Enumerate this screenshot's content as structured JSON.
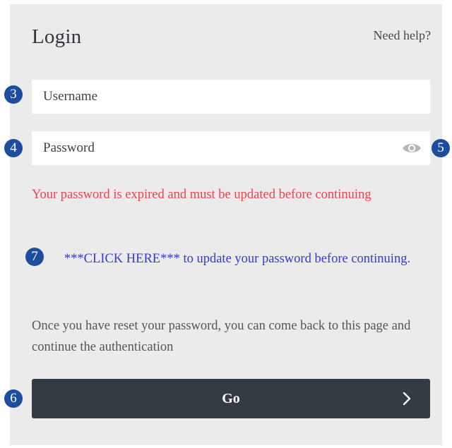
{
  "header": {
    "title": "Login",
    "help_link": "Need help?"
  },
  "form": {
    "username": {
      "placeholder": "Username"
    },
    "password": {
      "placeholder": "Password",
      "toggle_icon": "eye-icon"
    }
  },
  "messages": {
    "error": "Your password is expired and must be updated before continuing",
    "update_link": "***CLICK HERE*** to update your password before continuing.",
    "info": "Once you have reset your password, you can come back to this page and continue the authentication"
  },
  "go_button": {
    "label": "Go",
    "icon": "chevron-right-icon"
  },
  "markers": {
    "username": "3",
    "password": "4",
    "eye": "5",
    "go": "6",
    "link": "7"
  },
  "colors": {
    "panel_bg": "#ebebeb",
    "error": "#f0424a",
    "link": "#3436e8",
    "button_bg": "#343b42",
    "marker_bg": "#1f4d9e"
  }
}
